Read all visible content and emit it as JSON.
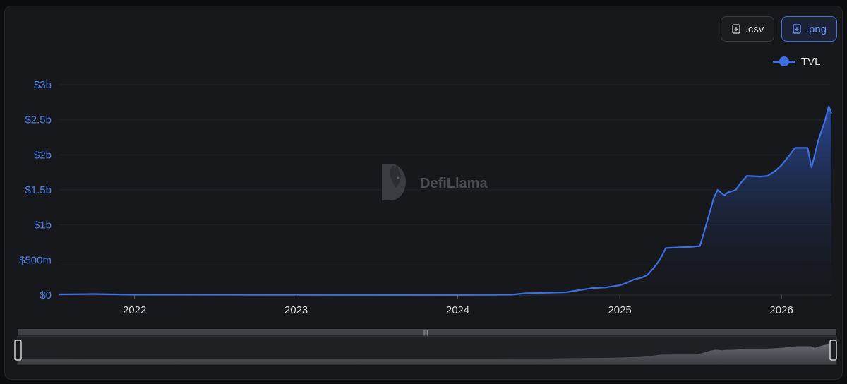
{
  "toolbar": {
    "csv_label": ".csv",
    "png_label": ".png"
  },
  "watermark": {
    "text": "DefiLlama"
  },
  "colors": {
    "series": "#3d6fe0",
    "y_ticks": "#4f7fe8",
    "x_ticks": "#d6d8dc",
    "background": "#17181c"
  },
  "chart_data": {
    "type": "area",
    "title": "",
    "xlabel": "",
    "ylabel": "",
    "x_ticks": [
      "2022",
      "2023",
      "2024",
      "2025",
      "2026"
    ],
    "y_ticks": [
      "$0",
      "$500m",
      "$1b",
      "$1.5b",
      "$2b",
      "$2.5b",
      "$3b"
    ],
    "ylim": [
      0,
      3000000000
    ],
    "xlim": [
      "2021-07-15",
      "2026-04-24"
    ],
    "grid": true,
    "legend_position": "top-right",
    "series": [
      {
        "name": "TVL",
        "color": "#3d6fe0",
        "points": [
          [
            "2021-07-15",
            10000000
          ],
          [
            "2021-10-01",
            15000000
          ],
          [
            "2022-01-01",
            5000000
          ],
          [
            "2023-01-01",
            3000000
          ],
          [
            "2024-01-01",
            2000000
          ],
          [
            "2024-05-01",
            5000000
          ],
          [
            "2024-06-01",
            25000000
          ],
          [
            "2024-09-01",
            40000000
          ],
          [
            "2024-10-01",
            70000000
          ],
          [
            "2024-11-01",
            100000000
          ],
          [
            "2024-12-01",
            110000000
          ],
          [
            "2025-01-01",
            140000000
          ],
          [
            "2025-01-15",
            170000000
          ],
          [
            "2025-02-01",
            220000000
          ],
          [
            "2025-02-20",
            250000000
          ],
          [
            "2025-03-05",
            290000000
          ],
          [
            "2025-03-20",
            400000000
          ],
          [
            "2025-04-01",
            500000000
          ],
          [
            "2025-04-15",
            670000000
          ],
          [
            "2025-05-15",
            680000000
          ],
          [
            "2025-06-15",
            690000000
          ],
          [
            "2025-07-01",
            700000000
          ],
          [
            "2025-07-15",
            1000000000
          ],
          [
            "2025-08-01",
            1380000000
          ],
          [
            "2025-08-10",
            1500000000
          ],
          [
            "2025-08-25",
            1420000000
          ],
          [
            "2025-09-01",
            1460000000
          ],
          [
            "2025-09-20",
            1500000000
          ],
          [
            "2025-10-01",
            1600000000
          ],
          [
            "2025-10-15",
            1700000000
          ],
          [
            "2025-11-15",
            1690000000
          ],
          [
            "2025-12-01",
            1700000000
          ],
          [
            "2025-12-20",
            1780000000
          ],
          [
            "2026-01-01",
            1850000000
          ],
          [
            "2026-01-20",
            2000000000
          ],
          [
            "2026-02-01",
            2100000000
          ],
          [
            "2026-03-01",
            2100000000
          ],
          [
            "2026-03-10",
            1820000000
          ],
          [
            "2026-03-25",
            2200000000
          ],
          [
            "2026-04-10",
            2500000000
          ],
          [
            "2026-04-18",
            2690000000
          ],
          [
            "2026-04-24",
            2590000000
          ]
        ]
      }
    ]
  }
}
